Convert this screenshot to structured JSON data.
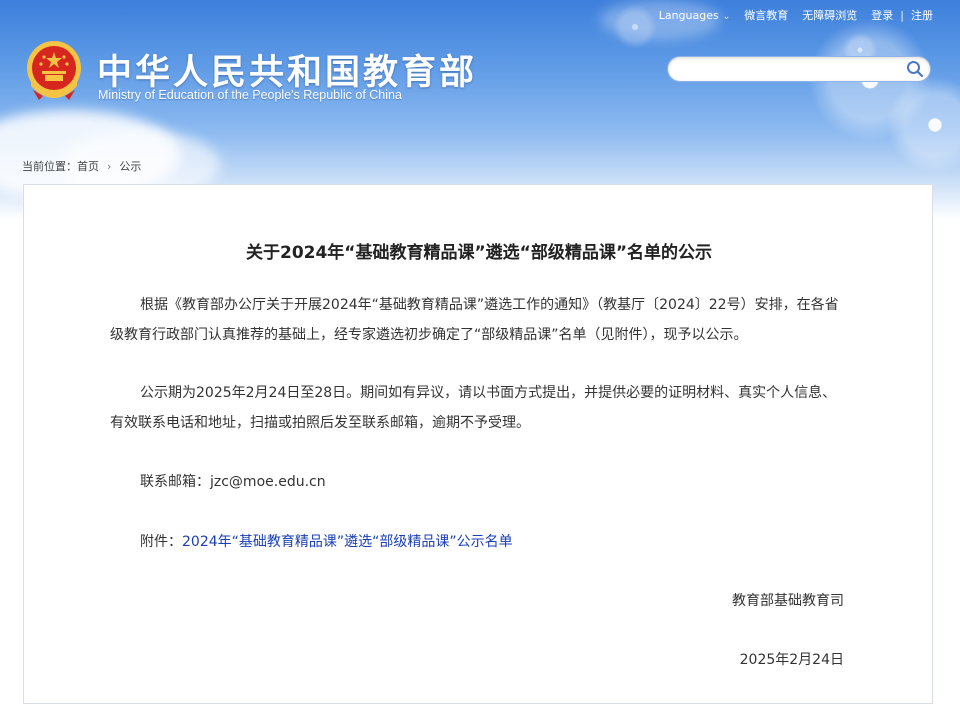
{
  "header": {
    "top_links": {
      "languages": "Languages",
      "weibo": "微言教育",
      "accessibility": "无障碍浏览",
      "login": "登录",
      "separator": "|",
      "register": "注册"
    },
    "site_title": "中华人民共和国教育部",
    "site_subtitle": "Ministry of Education of the People's Republic of China",
    "search": {
      "value": "",
      "placeholder": ""
    }
  },
  "breadcrumb": {
    "label": "当前位置：",
    "home": "首页",
    "arrow": "›",
    "current": "公示"
  },
  "article": {
    "title": "关于2024年“基础教育精品课”遴选“部级精品课”名单的公示",
    "paragraph1": "根据《教育部办公厅关于开展2024年“基础教育精品课”遴选工作的通知》（教基厅〔2024〕22号）安排，在各省级教育行政部门认真推荐的基础上，经专家遴选初步确定了“部级精品课”名单（见附件），现予以公示。",
    "paragraph2": "公示期为2025年2月24日至28日。期间如有异议，请以书面方式提出，并提供必要的证明材料、真实个人信息、有效联系电话和地址，扫描或拍照后发至联系邮箱，逾期不予受理。",
    "email_label": "联系邮箱：",
    "email": "jzc@moe.edu.cn",
    "attachment_label": "附件：",
    "attachment_link": "2024年“基础教育精品课”遴选“部级精品课”公示名单",
    "signature_org": "教育部基础教育司",
    "signature_date": "2025年2月24日"
  },
  "colors": {
    "header_blue": "#3d7fdc",
    "link_blue": "#1a3fb5",
    "emblem_red": "#d7261e",
    "emblem_gold": "#f6c445"
  },
  "icons": [
    "emblem-icon",
    "search-icon",
    "chevron-down-icon"
  ]
}
